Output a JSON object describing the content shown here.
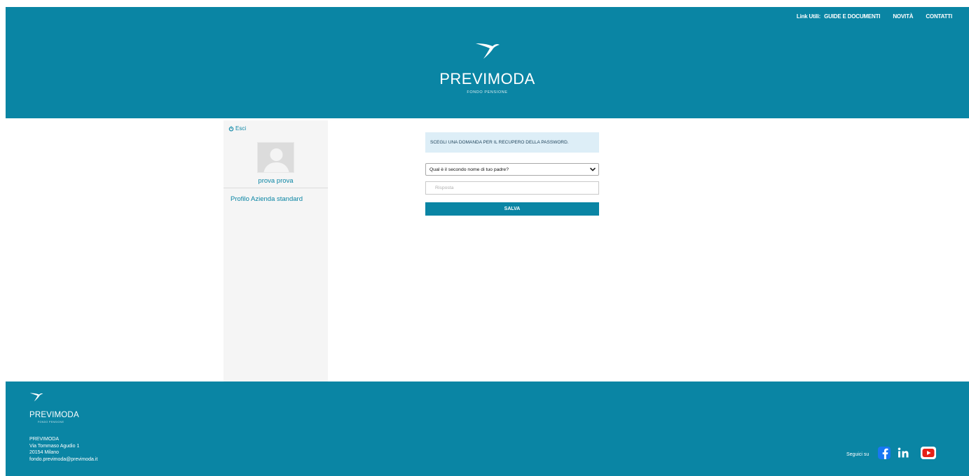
{
  "header": {
    "links_label": "Link Utili:",
    "links": [
      "GUIDE E DOCUMENTI",
      "NOVITÀ",
      "CONTATTI"
    ],
    "brand": "PREVIMODA",
    "brand_sub": "FONDO PENSIONE"
  },
  "sidebar": {
    "logout_label": "Esci",
    "user_name": "prova prova",
    "profile_link": "Profilo Azienda standard"
  },
  "form": {
    "info_text": "SCEGLI UNA DOMANDA PER IL RECUPERO DELLA PASSWORD.",
    "question_selected": "Qual è il secondo nome di tuo padre?",
    "answer_placeholder": "Risposta",
    "answer_value": "",
    "save_label": "SALVA"
  },
  "footer": {
    "brand": "PREVIMODA",
    "brand_sub": "FONDO PENSIONE",
    "address_lines": [
      "PREVIMODA",
      "Via Tommaso Agudio 1",
      "20154 Milano",
      "fondo.previmoda@previmoda.it"
    ],
    "follow_label": "Seguici su",
    "social_icons": [
      "facebook-icon",
      "linkedin-icon",
      "youtube-icon"
    ]
  },
  "colors": {
    "brand": "#0a85a4",
    "info_bg": "#ddeef7",
    "sidebar_bg": "#f5f5f5",
    "youtube": "#e62117",
    "facebook": "#1877f2"
  }
}
